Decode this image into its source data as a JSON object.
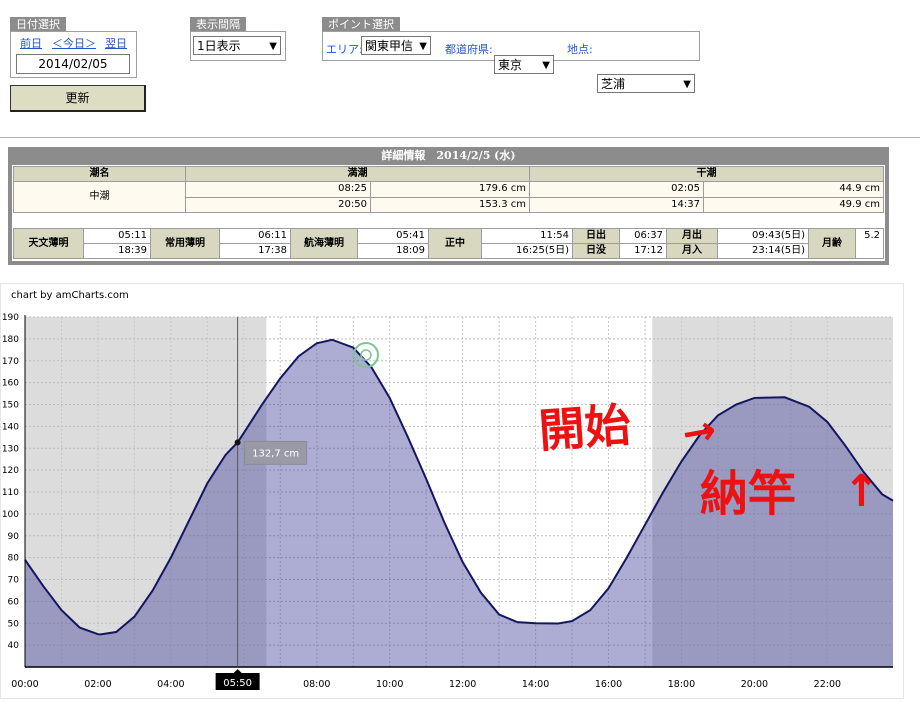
{
  "date_panel": {
    "label": "日付選択",
    "prev": "前日",
    "today": "＜今日＞",
    "next": "翌日",
    "date_value": "2014/02/05",
    "update_button": "更新"
  },
  "interval_panel": {
    "label": "表示間隔",
    "selected": "1日表示"
  },
  "point_panel": {
    "label": "ポイント選択",
    "area_label": "エリア:",
    "area_value": "関東甲信",
    "pref_label": "都道府県:",
    "pref_value": "東京",
    "spot_label": "地点:",
    "spot_value": "芝浦"
  },
  "detail": {
    "title": "詳細情報　2014/2/5 (水)",
    "tide_name_header": "潮名",
    "high_header": "満潮",
    "low_header": "干潮",
    "tide_name": "中潮",
    "high": [
      {
        "time": "08:25",
        "level": "179.6 cm"
      },
      {
        "time": "20:50",
        "level": "153.3 cm"
      }
    ],
    "low": [
      {
        "time": "02:05",
        "level": "44.9 cm"
      },
      {
        "time": "14:37",
        "level": "49.9 cm"
      }
    ],
    "astro": {
      "astronomical_twilight": {
        "label": "天文薄明",
        "values": [
          "05:11",
          "18:39"
        ]
      },
      "civil_twilight": {
        "label": "常用薄明",
        "values": [
          "06:11",
          "17:38"
        ]
      },
      "nautical_twilight": {
        "label": "航海薄明",
        "values": [
          "05:41",
          "18:09"
        ]
      },
      "meridian": {
        "label": "正中",
        "values": [
          "11:54",
          "16:25(5日)"
        ]
      },
      "sunrise": {
        "label": "日出",
        "value": "06:37"
      },
      "sunset": {
        "label": "日没",
        "value": "17:12"
      },
      "moonrise": {
        "label": "月出",
        "value": "09:43(5日)"
      },
      "moonset": {
        "label": "月入",
        "value": "23:14(5日)"
      },
      "moon_age": {
        "label": "月齢",
        "value": "5.2"
      }
    }
  },
  "chart_data": {
    "type": "area",
    "credit": "chart by amCharts.com",
    "x_unit": "hour",
    "xlim": [
      0,
      23.8
    ],
    "ylim": [
      30,
      190
    ],
    "y_ticks": [
      40,
      50,
      60,
      70,
      80,
      90,
      100,
      110,
      120,
      130,
      140,
      150,
      160,
      170,
      180,
      190
    ],
    "x_ticks": [
      "00:00",
      "02:00",
      "04:00",
      "06:00",
      "08:00",
      "10:00",
      "12:00",
      "14:00",
      "16:00",
      "18:00",
      "20:00",
      "22:00"
    ],
    "daylight": [
      6.62,
      17.2
    ],
    "series": [
      {
        "x": [
          0,
          0.5,
          1,
          1.5,
          2,
          2.08,
          2.5,
          3,
          3.5,
          4,
          4.5,
          5,
          5.5,
          5.83,
          6,
          6.5,
          7,
          7.5,
          8,
          8.42,
          9,
          9.5,
          10,
          10.5,
          11,
          11.5,
          12,
          12.5,
          13,
          13.5,
          14,
          14.62,
          15,
          15.5,
          16,
          16.5,
          17,
          17.5,
          18,
          18.5,
          19,
          19.5,
          20,
          20.83,
          21.5,
          22,
          22.5,
          23,
          23.5,
          23.8
        ],
        "y": [
          79,
          67,
          56,
          48,
          45,
          44.9,
          46,
          53,
          65,
          80,
          97,
          114,
          127,
          132.7,
          137,
          150,
          162,
          172,
          178,
          179.6,
          176,
          167,
          153,
          135,
          116,
          96,
          78,
          64,
          54,
          50.5,
          50,
          49.9,
          51,
          56,
          66,
          80,
          95,
          110,
          124,
          136,
          145,
          150,
          153,
          153.3,
          149,
          142,
          131,
          119,
          109,
          106
        ]
      }
    ],
    "cursor": {
      "time_label": "05:50",
      "value_label": "132,7 cm",
      "x": 5.83,
      "y": 132.7
    }
  },
  "annotations": {
    "text1": "開始",
    "text2": "納竿",
    "arrow1": "→",
    "arrow2": "↑"
  }
}
